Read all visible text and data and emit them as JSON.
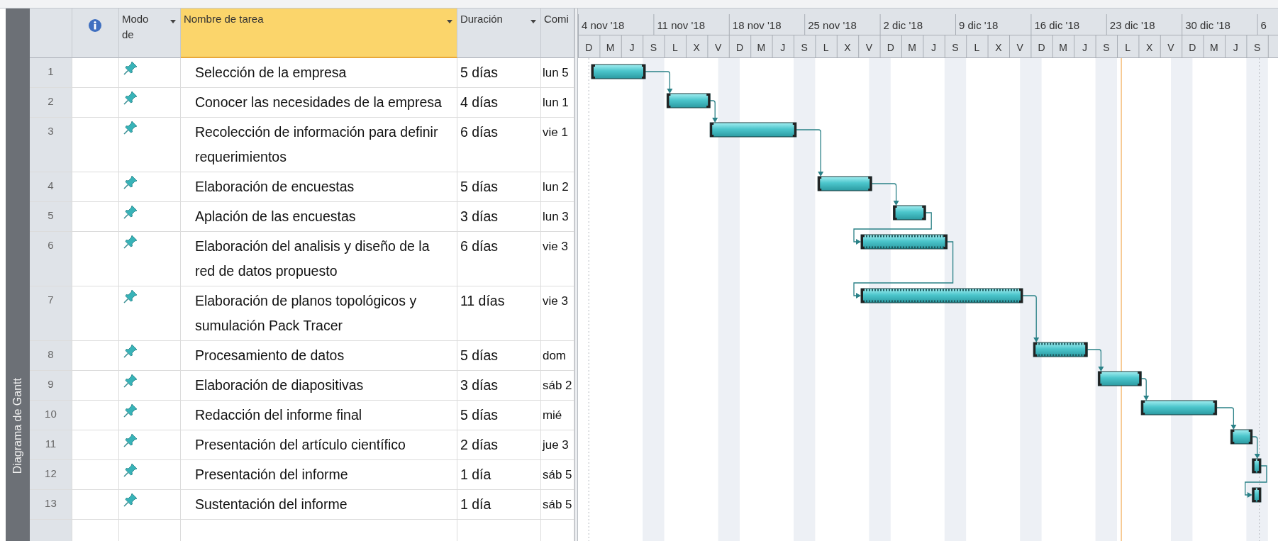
{
  "sidebar": {
    "label": "Diagrama de Gantt"
  },
  "table": {
    "columns": [
      {
        "label": "Modo de",
        "has_dropdown": true,
        "selected": false
      },
      {
        "label": "Nombre de tarea",
        "has_dropdown": true,
        "selected": true
      },
      {
        "label": "Duración",
        "has_dropdown": true,
        "selected": false
      },
      {
        "label": "Comi",
        "has_dropdown": false,
        "selected": false
      }
    ],
    "rows": [
      {
        "id": "1",
        "name": "Selección de la empresa",
        "duration": "5 días",
        "start": "lun 5"
      },
      {
        "id": "2",
        "name": "Conocer  las necesidades de la empresa",
        "duration": "4 días",
        "start": "lun 1"
      },
      {
        "id": "3",
        "name": "Recolección de información para definir requerimientos",
        "duration": "6 días",
        "start": "vie 1"
      },
      {
        "id": "4",
        "name": "Elaboración de encuestas",
        "duration": "5 días",
        "start": "lun 2"
      },
      {
        "id": "5",
        "name": "Aplación de las encuestas",
        "duration": "3 días",
        "start": "lun 3"
      },
      {
        "id": "6",
        "name": "Elaboración del analisis y diseño de la red de datos propuesto",
        "duration": "6 días",
        "start": "vie 3"
      },
      {
        "id": "7",
        "name": "Elaboración de planos topológicos y sumulación Pack Tracer",
        "duration": "11 días",
        "start": "vie 3"
      },
      {
        "id": "8",
        "name": "Procesamiento de datos",
        "duration": "5 días",
        "start": "dom"
      },
      {
        "id": "9",
        "name": "Elaboración de diapositivas",
        "duration": "3 días",
        "start": "sáb 2"
      },
      {
        "id": "10",
        "name": "Redacción del informe final",
        "duration": "5 días",
        "start": "mié"
      },
      {
        "id": "11",
        "name": "Presentación del artículo científico",
        "duration": "2 días",
        "start": "jue 3"
      },
      {
        "id": "12",
        "name": "Presentación del informe",
        "duration": "1 día",
        "start": "sáb 5"
      },
      {
        "id": "13",
        "name": "Sustentación del informe",
        "duration": "1 día",
        "start": "sáb 5"
      }
    ]
  },
  "gantt": {
    "weeks": [
      "4 nov '18",
      "11 nov '18",
      "18 nov '18",
      "25 nov '18",
      "2 dic '18",
      "9 dic '18",
      "16 dic '18",
      "23 dic '18",
      "30 dic '18",
      "6"
    ],
    "day_labels": [
      "D",
      "M",
      "J",
      "S",
      "L",
      "X",
      "V",
      "D",
      "M",
      "J",
      "S",
      "L",
      "X",
      "V",
      "D",
      "M",
      "J",
      "S",
      "L",
      "X",
      "V",
      "D",
      "M",
      "J",
      "S",
      "L",
      "X",
      "V",
      "D",
      "M",
      "J",
      "S"
    ]
  }
}
